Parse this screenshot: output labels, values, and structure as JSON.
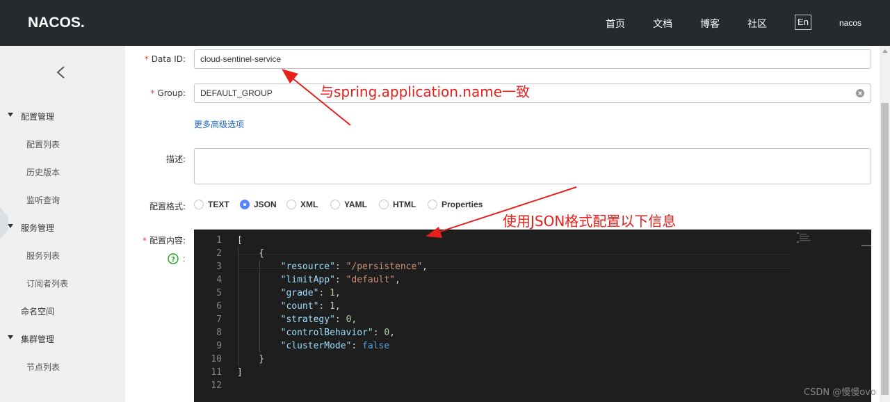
{
  "header": {
    "logo": "NACOS.",
    "nav": [
      "首页",
      "文档",
      "博客",
      "社区"
    ],
    "lang_button": "En",
    "user": "nacos"
  },
  "sidebar": {
    "groups": [
      {
        "label": "配置管理",
        "items": [
          "配置列表",
          "历史版本",
          "监听查询"
        ]
      },
      {
        "label": "服务管理",
        "items": [
          "服务列表",
          "订阅者列表"
        ]
      },
      {
        "label": "命名空间",
        "items": []
      },
      {
        "label": "集群管理",
        "items": [
          "节点列表"
        ]
      }
    ]
  },
  "form": {
    "data_id_label": "Data ID:",
    "data_id_value": "cloud-sentinel-service",
    "group_label": "Group:",
    "group_value": "DEFAULT_GROUP",
    "advanced_link": "更多高级选项",
    "desc_label": "描述:",
    "format_label": "配置格式:",
    "formats": [
      "TEXT",
      "JSON",
      "XML",
      "YAML",
      "HTML",
      "Properties"
    ],
    "selected_format": "JSON",
    "content_label": "配置内容:",
    "help_suffix": ":",
    "required_mark": "*"
  },
  "editor": {
    "line_numbers": [
      "1",
      "2",
      "3",
      "4",
      "5",
      "6",
      "7",
      "8",
      "9",
      "10",
      "11",
      "12"
    ],
    "lines": [
      "[",
      "    {",
      "        \"resource\": \"/persistence\",",
      "        \"limitApp\": \"default\",",
      "        \"grade\": 1,",
      "        \"count\": 1,",
      "        \"strategy\": 0,",
      "        \"controlBehavior\": 0,",
      "        \"clusterMode\": false",
      "    }",
      "]",
      ""
    ]
  },
  "annotations": {
    "group_note": "与spring.application.name一致",
    "content_note": "使用JSON格式配置以下信息"
  },
  "watermark": "CSDN @慢慢ovo"
}
